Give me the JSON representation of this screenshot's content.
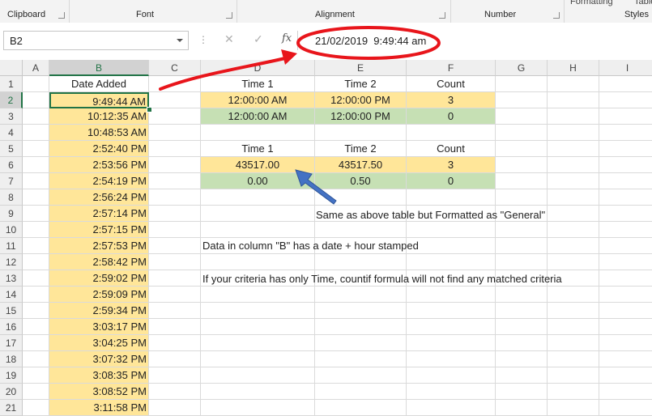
{
  "ribbon": {
    "groups": [
      "Clipboard",
      "Font",
      "Alignment",
      "Number",
      "Styles"
    ],
    "top_fragments": [
      "Formatting",
      "Table"
    ]
  },
  "formula_bar": {
    "name_box": "B2",
    "formula": "21/02/2019  9:49:44 am"
  },
  "sheet": {
    "columns": [
      "A",
      "B",
      "C",
      "D",
      "E",
      "F",
      "G",
      "H",
      "I"
    ],
    "rows": [
      1,
      2,
      3,
      4,
      5,
      6,
      7,
      8,
      9,
      10,
      11,
      12,
      13,
      14,
      15,
      16,
      17,
      18,
      19,
      20,
      21
    ],
    "selected_cell": "B2",
    "column_b": {
      "header": "Date Added",
      "values": [
        "9:49:44 AM",
        "10:12:35 AM",
        "10:48:53 AM",
        "2:52:40 PM",
        "2:53:56 PM",
        "2:54:19 PM",
        "2:56:24 PM",
        "2:57:14 PM",
        "2:57:15 PM",
        "2:57:53 PM",
        "2:58:42 PM",
        "2:59:02 PM",
        "2:59:09 PM",
        "2:59:34 PM",
        "3:03:17 PM",
        "3:04:25 PM",
        "3:07:32 PM",
        "3:08:35 PM",
        "3:08:52 PM",
        "3:11:58 PM"
      ]
    },
    "table1": {
      "headers": [
        "Time 1",
        "Time 2",
        "Count"
      ],
      "rows": [
        [
          "12:00:00 AM",
          "12:00:00 PM",
          "3"
        ],
        [
          "12:00:00 AM",
          "12:00:00 PM",
          "0"
        ]
      ]
    },
    "table2": {
      "headers": [
        "Time 1",
        "Time 2",
        "Count"
      ],
      "rows": [
        [
          "43517.00",
          "43517.50",
          "3"
        ],
        [
          "0.00",
          "0.50",
          "0"
        ]
      ]
    },
    "notes": {
      "general": "Same as above table but Formatted as \"General\"",
      "column_b": "Data in column \"B\" has a date + hour stamped",
      "criteria": "If your criteria has only Time, countif formula will not find any matched criteria"
    }
  },
  "colors": {
    "yellow_fill": "#ffe699",
    "green_fill": "#c6e0b4",
    "selection": "#217346",
    "annotation_red": "#e8151b",
    "arrow_blue": "#4472c4"
  }
}
